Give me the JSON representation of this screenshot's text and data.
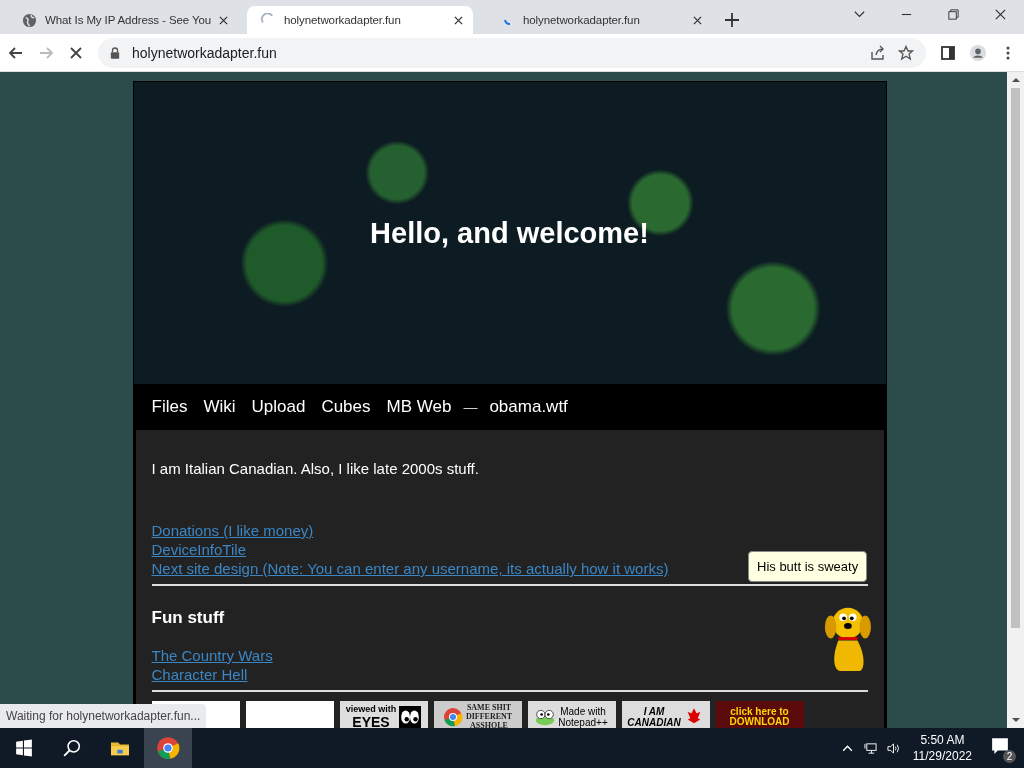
{
  "tabs": [
    {
      "title": "What Is My IP Address - See You",
      "kind": "globe",
      "selected": false
    },
    {
      "title": "holynetworkadapter.fun",
      "kind": "spinner",
      "selected": true
    },
    {
      "title": "holynetworkadapter.fun",
      "kind": "loading",
      "selected": false
    }
  ],
  "address": "holynetworkadapter.fun",
  "header": {
    "title": "Hello, and welcome!"
  },
  "nav": [
    {
      "label": "Files",
      "kind": "link"
    },
    {
      "label": "Wiki",
      "kind": "link"
    },
    {
      "label": "Upload",
      "kind": "link"
    },
    {
      "label": "Cubes",
      "kind": "link"
    },
    {
      "label": "MB Web",
      "kind": "link"
    },
    {
      "label": "—",
      "kind": "separator"
    },
    {
      "label": "obama.wtf",
      "kind": "link"
    }
  ],
  "intro": "I am Italian Canadian. Also, I like late 2000s stuff.",
  "links": [
    "Donations (I like money)",
    "DeviceInfoTile",
    "Next site design (Note: You can enter any username, its actually how it works)"
  ],
  "fun_heading": "Fun stuff",
  "fun_links": [
    "The Country Wars",
    "Character Hell"
  ],
  "badges": [
    {
      "kind": "blank"
    },
    {
      "kind": "blank"
    },
    {
      "kind": "eyes",
      "lines": [
        "viewed with",
        "EYES"
      ]
    },
    {
      "kind": "chrome",
      "lines": [
        "SAME SHIT",
        "DIFFERENT",
        "ASSHOLE"
      ]
    },
    {
      "kind": "frog",
      "lines": [
        "Made with",
        "Notepad++"
      ]
    },
    {
      "kind": "canadian",
      "lines": [
        "I AM",
        "CANADIAN"
      ]
    },
    {
      "kind": "download",
      "lines": [
        "click here to",
        "DOWNLOAD"
      ]
    }
  ],
  "tooltip": "His butt is sweaty",
  "status": "Waiting for holynetworkadapter.fun...",
  "taskbar": {
    "time": "5:50 AM",
    "date": "11/29/2022",
    "notifications": "2"
  }
}
